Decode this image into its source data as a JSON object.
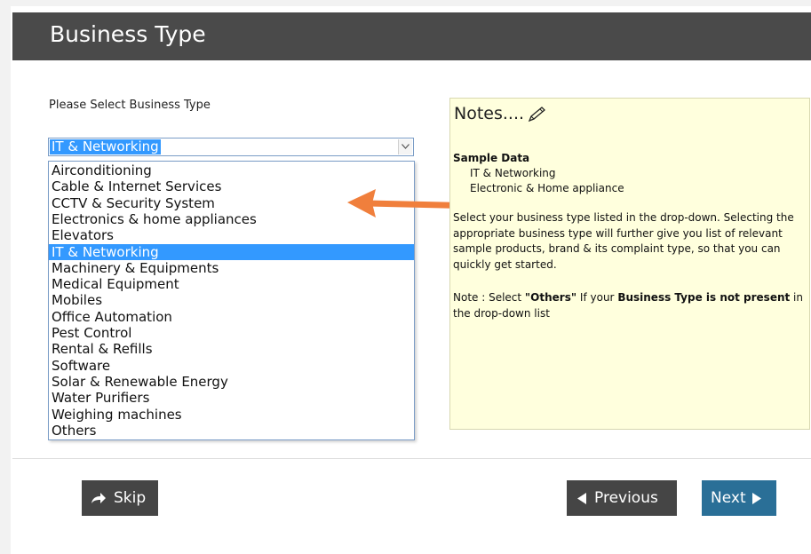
{
  "header": {
    "title": "Business Type"
  },
  "form": {
    "prompt": "Please Select Business Type",
    "selected_value": "IT & Networking",
    "options": [
      "Airconditioning",
      "Cable & Internet Services",
      "CCTV & Security System",
      "Electronics & home appliances",
      "Elevators",
      "IT & Networking",
      "Machinery & Equipments",
      "Medical Equipment",
      "Mobiles",
      "Office Automation",
      "Pest Control",
      "Rental & Refills",
      "Software",
      "Solar & Renewable Energy",
      "Water Purifiers",
      "Weighing machines",
      "Others"
    ],
    "selected_index": 5
  },
  "notes": {
    "title": "Notes....",
    "sample_title": "Sample Data",
    "sample_items": [
      "IT & Networking",
      "Electronic & Home appliance"
    ],
    "paragraph": "Select your business type listed in the drop-down. Selecting the appropriate business type will further give you list of relevant sample products, brand & its complaint type, so that you can quickly get started.",
    "note_prefix": "Note : Select ",
    "note_others": "\"Others\"",
    "note_mid": " If your ",
    "note_bold": "Business Type is not present",
    "note_suffix": " in the drop-down list"
  },
  "buttons": {
    "skip": "Skip",
    "previous": "Previous",
    "next": "Next"
  },
  "colors": {
    "header_bg": "#4a4a4a",
    "highlight": "#3399ff",
    "notes_bg": "#ffffdd",
    "arrow": "#f07f3c",
    "next_bg": "#2a6f97"
  },
  "icons": {
    "skip": "share-arrow-icon",
    "previous": "triangle-left-icon",
    "next": "triangle-right-icon",
    "notes": "pencil-icon",
    "select": "chevron-down-icon"
  }
}
